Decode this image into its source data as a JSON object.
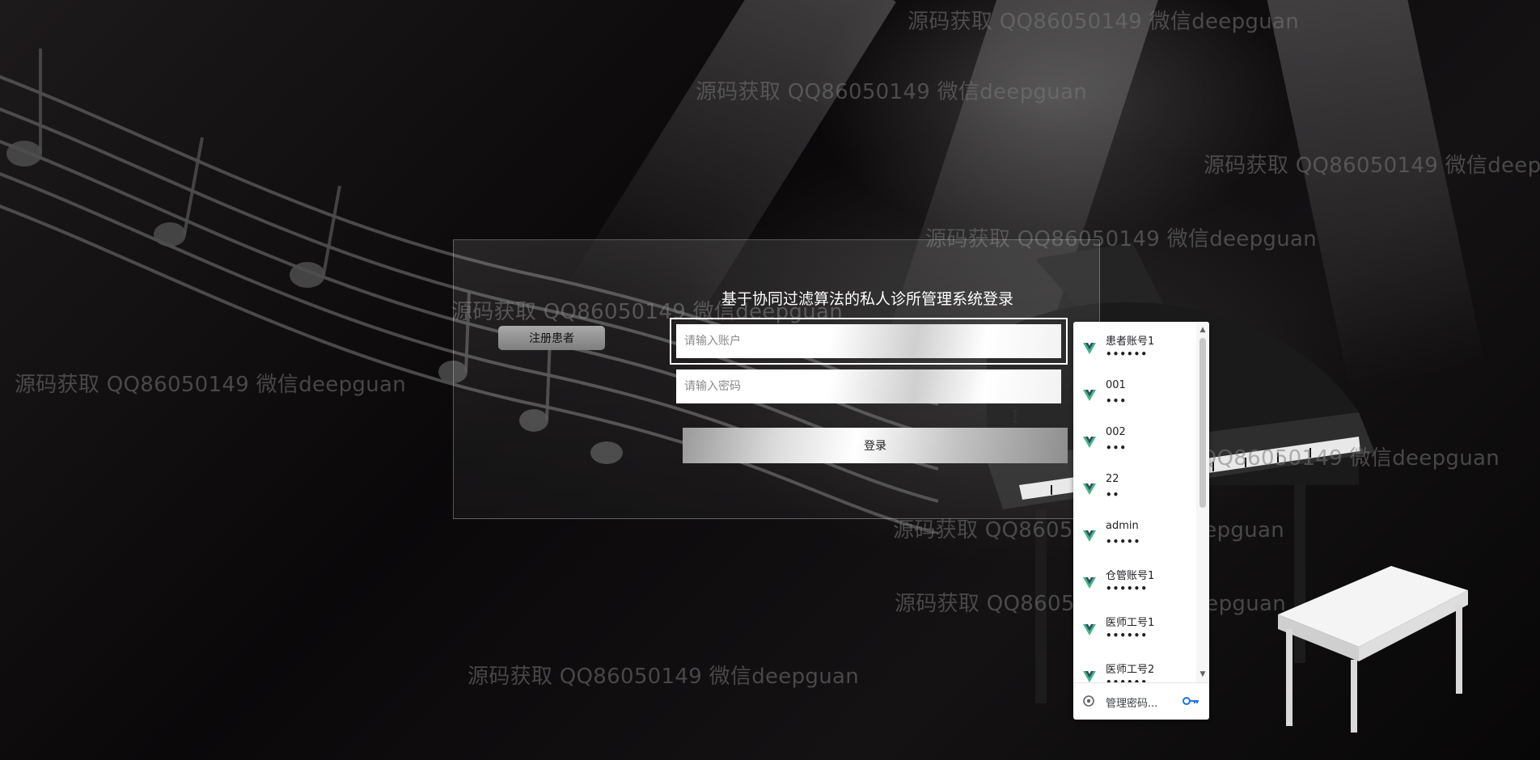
{
  "watermark_text": "源码获取 QQ86050149 微信deepguan",
  "login": {
    "title": "基于协同过滤算法的私人诊所管理系统登录",
    "register_label": "注册患者",
    "account_placeholder": "请输入账户",
    "password_placeholder": "请输入密码",
    "submit_label": "登录"
  },
  "autofill": {
    "icon": "vue-logo-icon",
    "items": [
      {
        "user": "患者账号1",
        "pass": "••••••"
      },
      {
        "user": "001",
        "pass": "•••"
      },
      {
        "user": "002",
        "pass": "•••"
      },
      {
        "user": "22",
        "pass": "••"
      },
      {
        "user": "admin",
        "pass": "•••••"
      },
      {
        "user": "仓管账号1",
        "pass": "••••••"
      },
      {
        "user": "医师工号1",
        "pass": "••••••"
      },
      {
        "user": "医师工号2",
        "pass": "••••••"
      }
    ],
    "manage_label": "管理密码..."
  },
  "colors": {
    "vue_green": "#41b883",
    "vue_dark": "#35495e",
    "watermark": "#7a7a7a"
  }
}
